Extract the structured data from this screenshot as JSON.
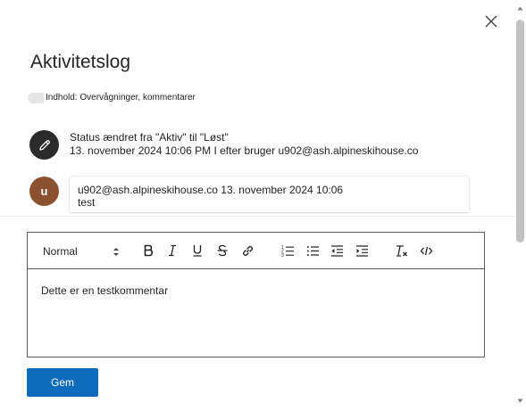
{
  "panel": {
    "title": "Aktivitetslog",
    "filter_chip": "Indhold: Overvågninger, kommentarer"
  },
  "activities": {
    "status_change": {
      "icon": "pencil-icon",
      "line1": "Status ændret fra \"Aktiv\" til \"Løst\"",
      "line2": "13. november 2024 10:06 PM I efter bruger u902@ash.alpineskihouse.co"
    },
    "comment": {
      "avatar_initial": "u",
      "avatar_color": "#8a5130",
      "header": "u902@ash.alpineskihouse.co 13. november 2024 10:06",
      "body": "test"
    }
  },
  "editor": {
    "format_value": "Normal",
    "content": "Dette er en testkommentar",
    "toolbar_icons": [
      "bold-icon",
      "italic-icon",
      "underline-icon",
      "strikethrough-icon",
      "link-icon",
      "numbered-list-icon",
      "bulleted-list-icon",
      "outdent-icon",
      "indent-icon",
      "clear-formatting-icon",
      "code-icon"
    ]
  },
  "actions": {
    "save_label": "Gem"
  },
  "colors": {
    "accent": "#0f6cbd",
    "text": "#242424"
  }
}
